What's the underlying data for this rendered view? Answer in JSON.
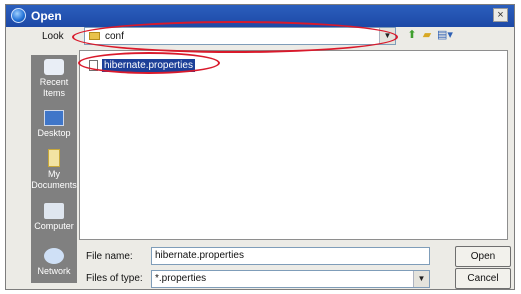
{
  "dialog": {
    "title": "Open",
    "close_glyph": "×"
  },
  "look_in": {
    "label": "Look",
    "value": "conf"
  },
  "places": [
    {
      "label": "Recent Items",
      "icon": "recent-items-icon"
    },
    {
      "label": "Desktop",
      "icon": "desktop-icon"
    },
    {
      "label": "My Documents",
      "icon": "my-documents-icon"
    },
    {
      "label": "Computer",
      "icon": "computer-icon"
    },
    {
      "label": "Network",
      "icon": "network-icon"
    }
  ],
  "files": [
    {
      "name": "hibernate.properties",
      "selected": true
    }
  ],
  "file_name": {
    "label": "File name:",
    "value": "hibernate.properties"
  },
  "file_type": {
    "label": "Files of type:",
    "value": "*.properties"
  },
  "buttons": {
    "open": "Open",
    "cancel": "Cancel"
  },
  "colors": {
    "titlebar": "#1d49a6",
    "annotation": "#d9192b",
    "selection": "#1c3f98"
  }
}
